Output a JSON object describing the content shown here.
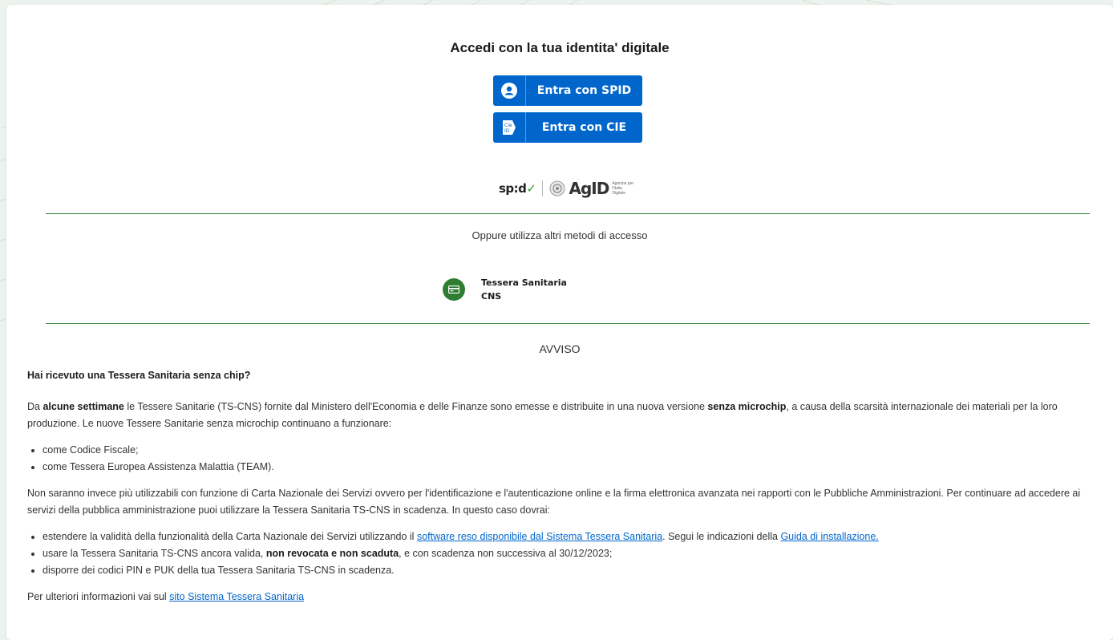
{
  "title": "Accedi con la tua identita' digitale",
  "buttons": {
    "spid": "Entra con SPID",
    "cie": "Entra con CIE"
  },
  "logos": {
    "spid_main": "sp:d",
    "spid_check": "✓",
    "agid": "AgID",
    "agid_sub": "Agenzia per l'Italia Digitale"
  },
  "other_methods": "Oppure utilizza altri metodi di accesso",
  "ts_option": {
    "line1": "Tessera Sanitaria",
    "line2": "CNS"
  },
  "avviso": "AVVISO",
  "notice": {
    "heading": "Hai ricevuto una Tessera Sanitaria senza chip?",
    "p1_a": "Da ",
    "p1_b": "alcune settimane",
    "p1_c": " le Tessere Sanitarie (TS-CNS) fornite dal Ministero dell'Economia e delle Finanze sono emesse e distribuite in una nuova versione ",
    "p1_d": "senza microchip",
    "p1_e": ", a causa della scarsità internazionale dei materiali per la loro produzione. Le nuove Tessere Sanitarie senza microchip continuano a funzionare:",
    "list1": [
      "come Codice Fiscale;",
      "come Tessera Europea Assistenza Malattia (TEAM)."
    ],
    "p2": "Non saranno invece più utilizzabili con funzione di Carta Nazionale dei Servizi ovvero per l'identificazione e l'autenticazione online e la firma elettronica avanzata nei rapporti con le Pubbliche Amministrazioni. Per continuare ad accedere ai servizi della pubblica amministrazione puoi utilizzare la Tessera Sanitaria TS-CNS in scadenza. In questo caso dovrai:",
    "li2_1a": "estendere la validità della funzionalità della Carta Nazionale dei Servizi utilizzando il ",
    "li2_1_link": "software reso disponibile dal Sistema Tessera Sanitaria",
    "li2_1b": ". Segui le indicazioni della ",
    "li2_1_link2": "Guida di installazione.",
    "li2_2a": "usare la Tessera Sanitaria TS-CNS ancora valida, ",
    "li2_2b": "non revocata e non scaduta",
    "li2_2c": ", e con scadenza non successiva al 30/12/2023;",
    "li2_3": "disporre dei codici PIN e PUK della tua Tessera Sanitaria TS-CNS in scadenza.",
    "p3_a": "Per ulteriori informazioni vai sul ",
    "p3_link": "sito Sistema Tessera Sanitaria"
  },
  "colors": {
    "primary": "#0066cc",
    "green": "#2e7d32",
    "link": "#0066cc"
  }
}
